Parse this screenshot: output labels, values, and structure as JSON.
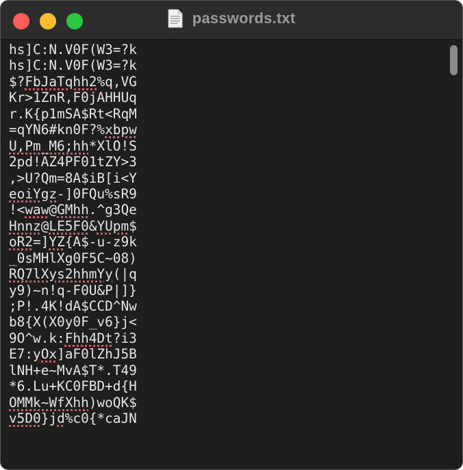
{
  "window": {
    "title": "passwords.txt",
    "file_icon": "document-icon",
    "traffic_lights": {
      "close": "#ff5f57",
      "minimize": "#febc2e",
      "zoom": "#28c840"
    }
  },
  "editor": {
    "lines": [
      [
        {
          "t": "hs]C:N.V0F(W3=?k"
        }
      ],
      [
        {
          "t": "hs]C:N.V0F(W3=?k"
        }
      ],
      [
        {
          "t": "$?"
        },
        {
          "t": "FbJaTqhh2",
          "e": true
        },
        {
          "t": "%q,VG"
        }
      ],
      [
        {
          "t": "Kr>1ZnR,F0jAHHUq"
        }
      ],
      [
        {
          "t": "r.K{p1mSA$Rt<RqM"
        }
      ],
      [
        {
          "t": "=qYN6#kn0F?%"
        },
        {
          "t": "xbpw",
          "e": true
        }
      ],
      [
        {
          "t": "U,Pm_M6;hh",
          "e": true
        },
        {
          "t": "*XlO!S"
        }
      ],
      [
        {
          "t": "2pd!AZ4PF01tZY>3"
        }
      ],
      [
        {
          "t": ",>U?Qm=8A$iB[i<Y"
        }
      ],
      [
        {
          "t": "eoiYgz",
          "e": true
        },
        {
          "t": "-]0FQu%sR9"
        }
      ],
      [
        {
          "t": "!<"
        },
        {
          "t": "waw",
          "e": true
        },
        {
          "t": "@"
        },
        {
          "t": "GMhh",
          "e": true
        },
        {
          "t": ".^g3Qe"
        }
      ],
      [
        {
          "t": "Hnnz",
          "e": true
        },
        {
          "t": "@"
        },
        {
          "t": "LE5F0",
          "e": true
        },
        {
          "t": "&"
        },
        {
          "t": "YUpm",
          "e": true
        },
        {
          "t": "$"
        }
      ],
      [
        {
          "t": "oR2",
          "e": true
        },
        {
          "t": "=]"
        },
        {
          "t": "YZ",
          "e": true
        },
        {
          "t": "{A$-u-z9k"
        }
      ],
      [
        {
          "t": "_0sMHlXg0F5C~08)"
        }
      ],
      [
        {
          "t": "RQ7lXys2hhmYy",
          "e": true
        },
        {
          "t": "(|q"
        }
      ],
      [
        {
          "t": "y9)~n!q-F0U&P|]}"
        }
      ],
      [
        {
          "t": ";P!.4K!dA$CCD^Nw"
        }
      ],
      [
        {
          "t": "b8{X(X0y0F_v6}j<"
        }
      ],
      [
        {
          "t": "9O^w.k:"
        },
        {
          "t": "Fhh4Dt",
          "e": true
        },
        {
          "t": "?i3"
        }
      ],
      [
        {
          "t": "E7:"
        },
        {
          "t": "yOx",
          "e": true
        },
        {
          "t": "]aF0lZhJ5B"
        }
      ],
      [
        {
          "t": "lNH+e~MvA$T*.T49"
        }
      ],
      [
        {
          "t": "*6.Lu+KC0FBD+d{H"
        }
      ],
      [
        {
          "t": "OMMk~WfXhh",
          "e": true
        },
        {
          "t": ")woQK$"
        }
      ],
      [
        {
          "t": "v5D0",
          "e": true
        },
        {
          "t": "}"
        },
        {
          "t": "jd",
          "e": true
        },
        {
          "t": "%c0{*caJN"
        }
      ]
    ]
  },
  "scrollbar": {
    "position_fraction": 0.0
  }
}
